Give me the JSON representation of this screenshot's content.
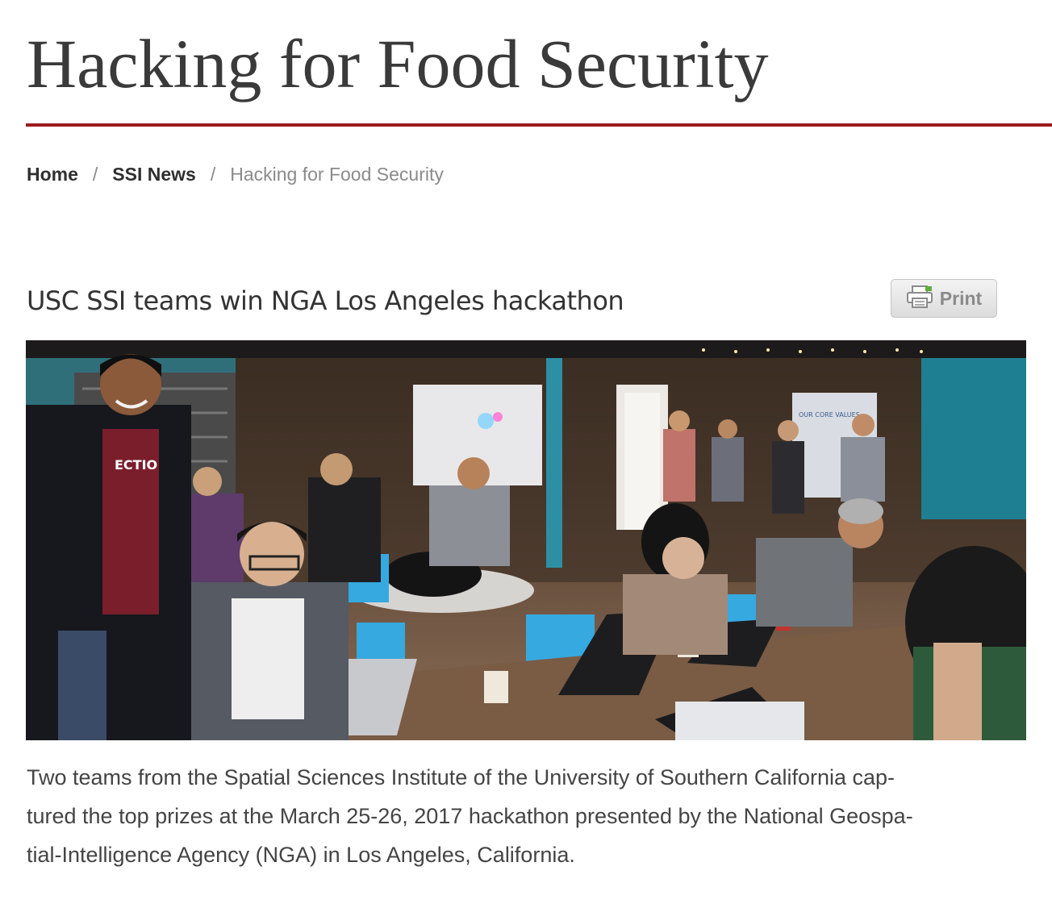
{
  "page": {
    "title": "Hacking for Food Security",
    "accent_color": "#9b1b1f"
  },
  "breadcrumb": {
    "items": [
      {
        "label": "Home"
      },
      {
        "label": "SSI News"
      },
      {
        "label": "Hacking for Food Security"
      }
    ],
    "separator": "/"
  },
  "article": {
    "title": "USC SSI teams win NGA Los Angeles hackathon",
    "print_label": "Print",
    "print_icon": "printer-icon",
    "photo_signs": {
      "shirt": "ECTIO",
      "banner": "OUR CORE VALUES"
    },
    "body_lines": [
      "Two teams from the Spatial Sciences Institute of the University of Southern California cap-",
      "tured the top prizes at the March 25-26, 2017 hackathon presented by the National Geospa-",
      "tial-Intelligence Agency (NGA) in Los Angeles, California."
    ]
  }
}
